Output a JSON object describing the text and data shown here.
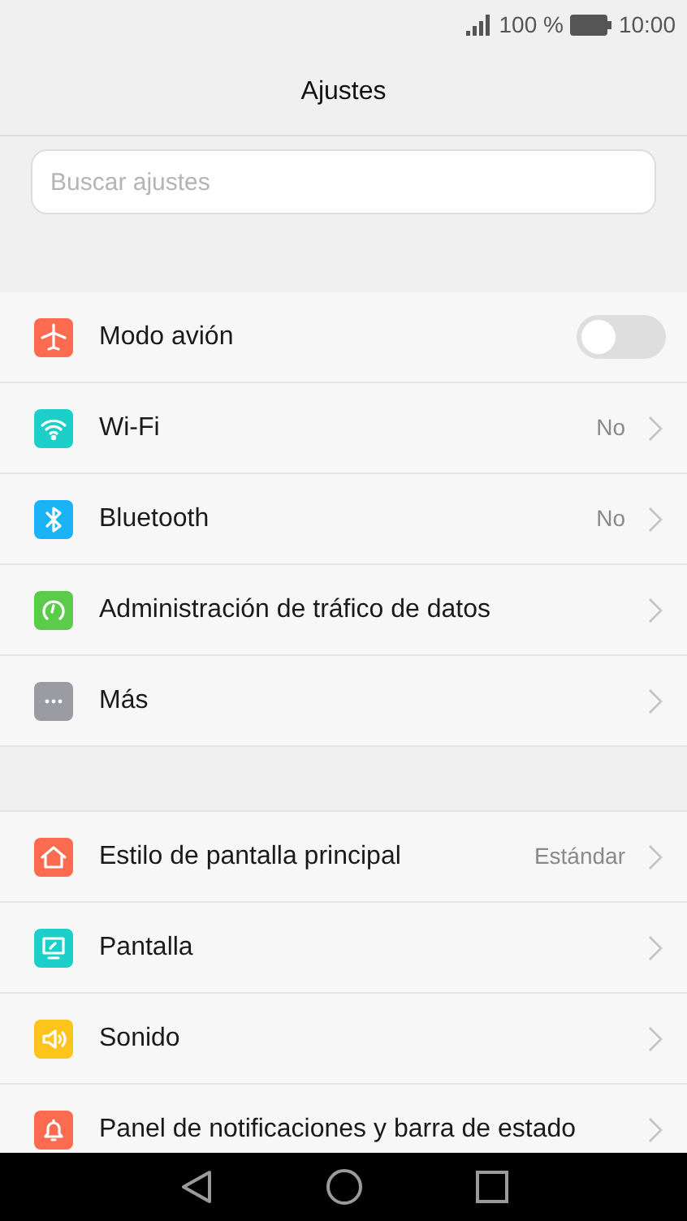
{
  "status_bar": {
    "battery": "100 %",
    "time": "10:00"
  },
  "title": "Ajustes",
  "search": {
    "placeholder": "Buscar ajustes"
  },
  "sections": [
    {
      "items": [
        {
          "kind": "toggle",
          "color": "#fa6b50",
          "label": "Modo avión",
          "on": false
        },
        {
          "kind": "link",
          "color": "#1ccfc8",
          "label": "Wi-Fi",
          "value": "No"
        },
        {
          "kind": "link",
          "color": "#1ab3f5",
          "label": "Bluetooth",
          "value": "No"
        },
        {
          "kind": "link",
          "color": "#5ccb4c",
          "label": "Administración de tráfico de datos"
        },
        {
          "kind": "link",
          "color": "#9a9ba3",
          "label": "Más"
        }
      ]
    },
    {
      "items": [
        {
          "kind": "link",
          "color": "#fa6b50",
          "label": "Estilo de pantalla principal",
          "value": "Estándar"
        },
        {
          "kind": "link",
          "color": "#1ccfc8",
          "label": "Pantalla"
        },
        {
          "kind": "link",
          "color": "#fdc51c",
          "label": "Sonido"
        },
        {
          "kind": "link",
          "color": "#fa6b50",
          "label": "Panel de notificaciones y barra de estado"
        }
      ]
    }
  ]
}
